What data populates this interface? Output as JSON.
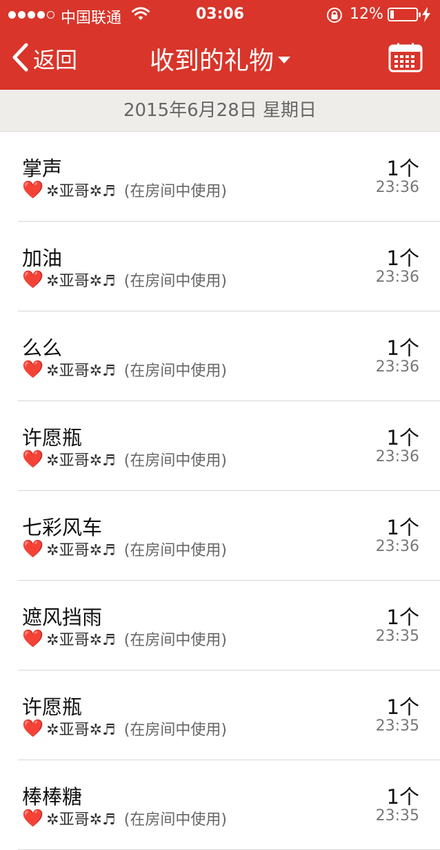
{
  "status_bar": {
    "carrier": "中国联通",
    "time": "03:06",
    "battery_percent": "12%",
    "battery_level": 0.12,
    "signal_bars_filled": 4,
    "signal_bars_total": 5
  },
  "nav": {
    "back_label": "返回",
    "title": "收到的礼物",
    "icons": [
      "chevron-left-icon",
      "caret-down-icon",
      "calendar-icon"
    ],
    "bar_color": "#d9352a"
  },
  "date_header": "2015年6月28日 星期日",
  "gifts": [
    {
      "name": "掌声",
      "heart": "❤️",
      "sender": "✲亚哥✲♬",
      "usage": "(在房间中使用)",
      "count": "1个",
      "time": "23:36"
    },
    {
      "name": "加油",
      "heart": "❤️",
      "sender": "✲亚哥✲♬",
      "usage": "(在房间中使用)",
      "count": "1个",
      "time": "23:36"
    },
    {
      "name": "么么",
      "heart": "❤️",
      "sender": "✲亚哥✲♬",
      "usage": "(在房间中使用)",
      "count": "1个",
      "time": "23:36"
    },
    {
      "name": "许愿瓶",
      "heart": "❤️",
      "sender": "✲亚哥✲♬",
      "usage": "(在房间中使用)",
      "count": "1个",
      "time": "23:36"
    },
    {
      "name": "七彩风车",
      "heart": "❤️",
      "sender": "✲亚哥✲♬",
      "usage": "(在房间中使用)",
      "count": "1个",
      "time": "23:36"
    },
    {
      "name": "遮风挡雨",
      "heart": "❤️",
      "sender": "✲亚哥✲♬",
      "usage": "(在房间中使用)",
      "count": "1个",
      "time": "23:35"
    },
    {
      "name": "许愿瓶",
      "heart": "❤️",
      "sender": "✲亚哥✲♬",
      "usage": "(在房间中使用)",
      "count": "1个",
      "time": "23:35"
    },
    {
      "name": "棒棒糖",
      "heart": "❤️",
      "sender": "✲亚哥✲♬",
      "usage": "(在房间中使用)",
      "count": "1个",
      "time": "23:35"
    }
  ]
}
